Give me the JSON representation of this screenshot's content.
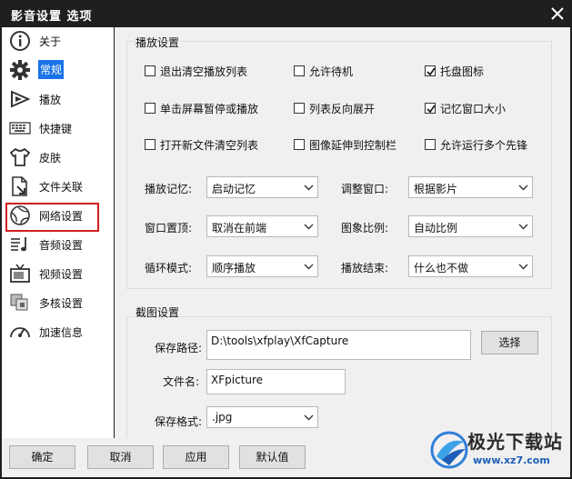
{
  "window": {
    "title": "影音设置 选项"
  },
  "sidebar": {
    "items": [
      {
        "label": "关于",
        "icon": "info-icon"
      },
      {
        "label": "常规",
        "icon": "gear-icon",
        "active": true
      },
      {
        "label": "播放",
        "icon": "play-icon"
      },
      {
        "label": "快捷键",
        "icon": "keyboard-icon"
      },
      {
        "label": "皮肤",
        "icon": "shirt-icon"
      },
      {
        "label": "文件关联",
        "icon": "file-link-icon"
      },
      {
        "label": "网络设置",
        "icon": "network-icon",
        "highlighted": true
      },
      {
        "label": "音频设置",
        "icon": "audio-icon"
      },
      {
        "label": "视频设置",
        "icon": "tv-icon"
      },
      {
        "label": "多核设置",
        "icon": "multicore-icon"
      },
      {
        "label": "加速信息",
        "icon": "speedometer-icon"
      }
    ]
  },
  "playback": {
    "group_title": "播放设置",
    "checkboxes": [
      {
        "label": "退出清空播放列表",
        "checked": false
      },
      {
        "label": "允许待机",
        "checked": false
      },
      {
        "label": "托盘图标",
        "checked": true
      },
      {
        "label": "单击屏幕暂停或播放",
        "checked": false
      },
      {
        "label": "列表反向展开",
        "checked": false
      },
      {
        "label": "记忆窗口大小",
        "checked": true
      },
      {
        "label": "打开新文件清空列表",
        "checked": false
      },
      {
        "label": "图像延伸到控制栏",
        "checked": false
      },
      {
        "label": "允许运行多个先锋",
        "checked": false
      }
    ],
    "selects": [
      {
        "label": "播放记忆:",
        "value": "启动记忆"
      },
      {
        "label": "调整窗口:",
        "value": "根据影片"
      },
      {
        "label": "窗口置顶:",
        "value": "取消在前端"
      },
      {
        "label": "图象比例:",
        "value": "自动比例"
      },
      {
        "label": "循环模式:",
        "value": "顺序播放"
      },
      {
        "label": "播放结束:",
        "value": "什么也不做"
      }
    ]
  },
  "capture": {
    "group_title": "截图设置",
    "path_label": "保存路径:",
    "path_value": "D:\\tools\\xfplay\\XfCapture",
    "browse_label": "选择",
    "filename_label": "文件名:",
    "filename_value": "XFpicture",
    "format_label": "保存格式:",
    "format_value": ".jpg"
  },
  "footer": {
    "ok": "确定",
    "cancel": "取消",
    "apply": "应用",
    "default": "默认值"
  },
  "watermark": {
    "text": "极光下载站",
    "url": "www.xz7.com"
  },
  "colors": {
    "accent": "#1a73e8",
    "highlight_border": "#d11f1f",
    "window_frame": "#1f1f1f"
  }
}
